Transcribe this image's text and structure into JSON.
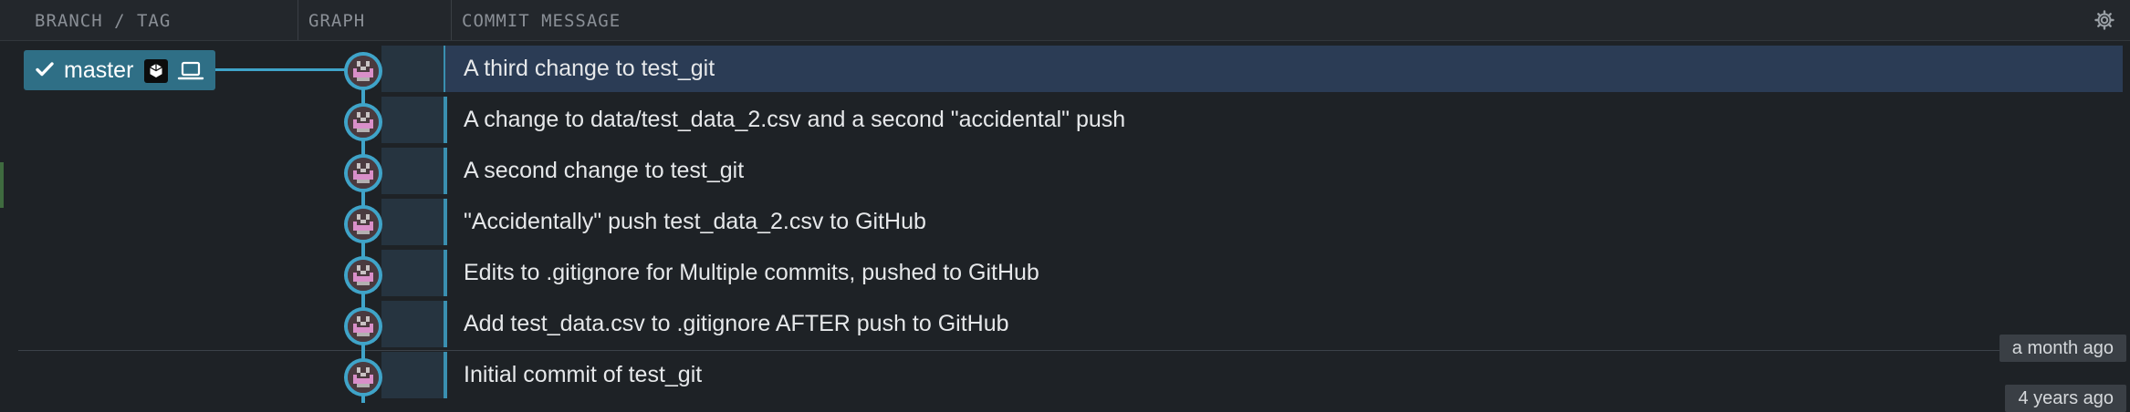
{
  "header": {
    "col_branch": "BRANCH / TAG",
    "col_graph": "GRAPH",
    "col_message": "COMMIT MESSAGE",
    "settings_icon": "gear-icon"
  },
  "branch": {
    "name": "master",
    "check_icon": "checkmark-icon",
    "hub_icon": "hosted-remote-icon",
    "local_icon": "laptop-icon"
  },
  "commits": [
    {
      "message": "A third change to test_git",
      "selected": true
    },
    {
      "message": "A change to data/test_data_2.csv and a second \"accidental\" push",
      "selected": false
    },
    {
      "message": "A second change to test_git",
      "selected": false
    },
    {
      "message": "\"Accidentally\" push test_data_2.csv to GitHub",
      "selected": false
    },
    {
      "message": "Edits to .gitignore for Multiple commits, pushed to GitHub",
      "selected": false
    },
    {
      "message": "Add test_data.csv to .gitignore AFTER push to GitHub",
      "selected": false
    },
    {
      "message": "Initial commit of test_git",
      "selected": false
    }
  ],
  "timestamps": {
    "recent": "a month ago",
    "older": "4 years ago"
  },
  "colors": {
    "accent": "#3fa4c9",
    "selected_row": "#2b3c55",
    "branch_bg": "#2f6f86"
  }
}
